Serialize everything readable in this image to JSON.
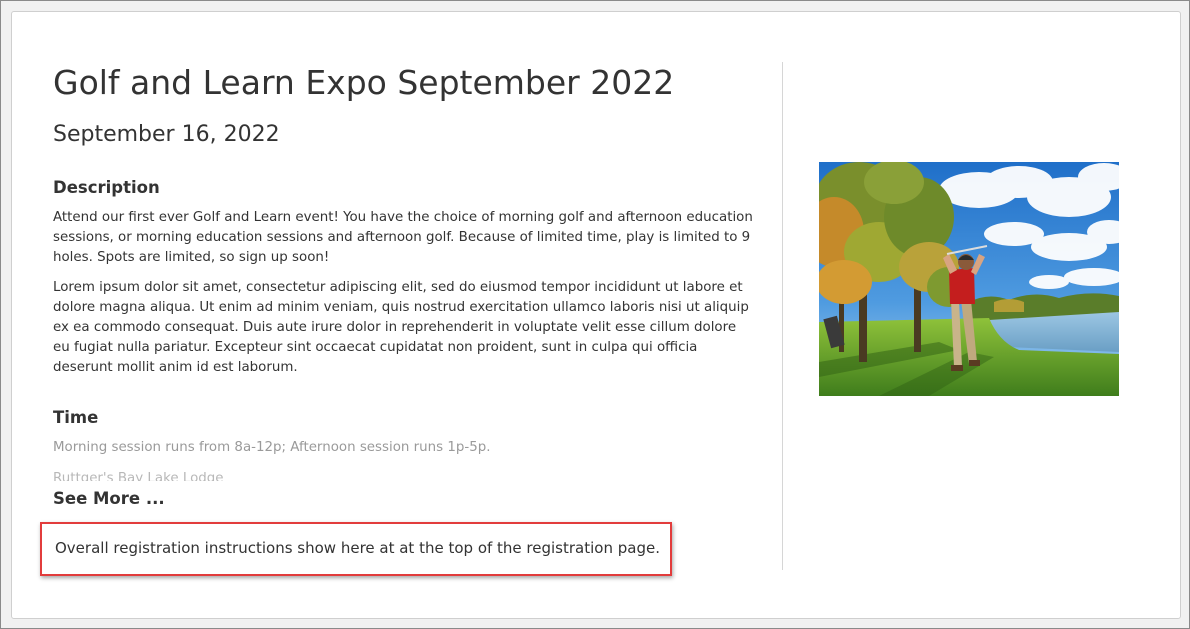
{
  "event": {
    "title": "Golf and Learn Expo September 2022",
    "date": "September 16, 2022",
    "image_alt": "golfer-swinging-photo"
  },
  "description": {
    "heading": "Description",
    "paragraphs": [
      "Attend our first ever Golf and Learn event! You have the choice of morning golf and afternoon education sessions, or morning education sessions and afternoon golf. Because of limited time, play is limited to 9 holes. Spots are limited, so sign up soon!",
      "Lorem ipsum dolor sit amet, consectetur adipiscing elit, sed do eiusmod tempor incididunt ut labore et dolore magna aliqua. Ut enim ad minim veniam, quis nostrud exercitation ullamco laboris nisi ut aliquip ex ea commodo consequat. Duis aute irure dolor in reprehenderit in voluptate velit esse cillum dolore eu fugiat nulla pariatur. Excepteur sint occaecat cupidatat non proident, sunt in culpa qui officia deserunt mollit anim id est laborum."
    ]
  },
  "time": {
    "heading": "Time",
    "text": "Morning session runs from 8a-12p; Afternoon session runs 1p-5p.",
    "location": "Ruttger's Bay Lake Lodge"
  },
  "see_more": {
    "label": "See More ..."
  },
  "registration": {
    "instructions": "Overall registration instructions show here at at the top of the registration page."
  },
  "colors": {
    "highlight_border": "#e23c3c",
    "text": "#333333",
    "muted_text": "#9a9a9a"
  }
}
